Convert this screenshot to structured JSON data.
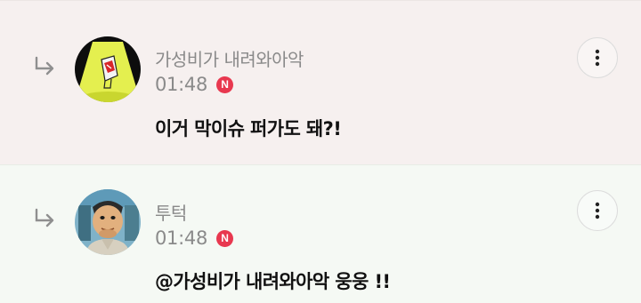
{
  "replies": [
    {
      "username": "가성비가 내려와아악",
      "time": "01:48",
      "badge": "N",
      "message": "이거 막이슈 퍼가도 돼?!",
      "avatar_icon": "yellow-lamp-avatar-icon",
      "background": "#f6f0ef"
    },
    {
      "username": "투턱",
      "time": "01:48",
      "badge": "N",
      "message": "@가성비가 내려와아악 웅웅 !!",
      "avatar_icon": "cartoon-character-avatar-icon",
      "background": "#f5f9f4"
    }
  ],
  "colors": {
    "badge": "#e8384f",
    "meta_text": "#8a8a8a",
    "message_text": "#111111"
  },
  "icons": {
    "reply_arrow": "reply-arrow-icon",
    "more": "more-vertical-icon"
  }
}
